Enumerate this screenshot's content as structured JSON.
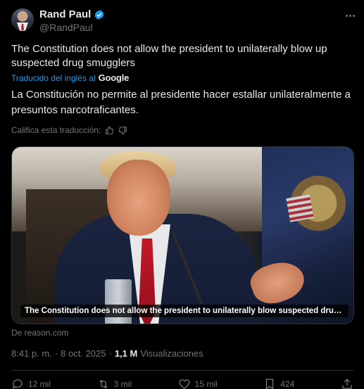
{
  "author": {
    "display_name": "Rand Paul",
    "handle": "@RandPaul",
    "verified": true
  },
  "tweet": {
    "text": "The Constitution does not allow the president to unilaterally blow up suspected drug smugglers",
    "translated_from": "Traducido del inglés al",
    "translation_provider": "Google",
    "translation": "La Constitución no permite al presidente hacer estallar unilateralmente a presuntos narcotraficantes.",
    "rate_translation_label": "Califica esta traducción:"
  },
  "media": {
    "caption": "The Constitution does not allow the president to unilaterally blow suspected drug smu...",
    "source": "De reason.com"
  },
  "meta": {
    "time": "8:41 p. m.",
    "separator": "·",
    "date": "8 oct. 2025",
    "separator2": "·",
    "views_count": "1,1 M",
    "views_label": "Visualizaciones"
  },
  "actions": {
    "replies": "12 mil",
    "reposts": "3 mil",
    "likes": "15 mil",
    "bookmarks": "424"
  },
  "colors": {
    "background": "#000000",
    "text": "#e7e9ea",
    "secondary": "#71767b",
    "accent": "#1d9bf0",
    "divider": "#2f3336"
  },
  "icons": [
    "verified-badge-icon",
    "more-icon",
    "thumbs-up-icon",
    "thumbs-down-icon",
    "reply-icon",
    "repost-icon",
    "like-icon",
    "bookmark-icon",
    "share-icon"
  ]
}
